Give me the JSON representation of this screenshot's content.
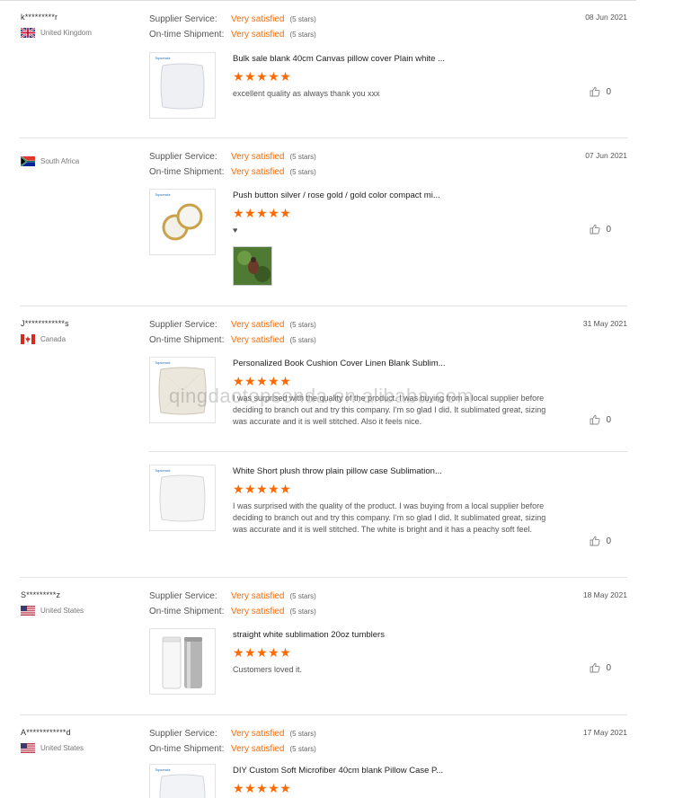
{
  "labels": {
    "supplier_service": "Supplier Service:",
    "ontime_shipment": "On-time Shipment:"
  },
  "watermark": "qingdaotopsenda.en.alibaba.com",
  "reviews": [
    {
      "user": "k*********r",
      "country": "United Kingdom",
      "flag": "uk",
      "date": "08 Jun 2021",
      "supplier_service": "Very satisfied",
      "supplier_service_stars": "(5 stars)",
      "ontime_shipment": "Very satisfied",
      "ontime_shipment_stars": "(5 stars)",
      "products": [
        {
          "title": "Bulk sale blank 40cm Canvas pillow cover Plain white ...",
          "stars": "★★★★★",
          "comment": "excellent quality as always thank you xxx",
          "likes": "0",
          "brand": "Topsenda"
        }
      ]
    },
    {
      "user": "",
      "country": "South Africa",
      "flag": "za",
      "date": "07 Jun 2021",
      "supplier_service": "Very satisfied",
      "supplier_service_stars": "(5 stars)",
      "ontime_shipment": "Very satisfied",
      "ontime_shipment_stars": "(5 stars)",
      "products": [
        {
          "title": "Push button silver / rose gold / gold color compact mi...",
          "stars": "★★★★★",
          "comment": "♥",
          "likes": "0",
          "brand": "Topsenda"
        }
      ]
    },
    {
      "user": "J************s",
      "country": "Canada",
      "flag": "ca",
      "date": "31 May 2021",
      "supplier_service": "Very satisfied",
      "supplier_service_stars": "(5 stars)",
      "ontime_shipment": "Very satisfied",
      "ontime_shipment_stars": "(5 stars)",
      "products": [
        {
          "title": "Personalized Book Cushion Cover Linen Blank Sublim...",
          "stars": "★★★★★",
          "comment": "I was surprised with the quality of the product. I was buying from a local supplier before deciding to branch out and try this company. I'm so glad I did. It sublimated great, sizing was accurate and it is well stitched. Also it feels nice.",
          "likes": "0",
          "brand": "Topsenda"
        },
        {
          "title": "White Short plush throw plain pillow case Sublimation...",
          "stars": "★★★★★",
          "comment": "I was surprised with the quality of the product. I was buying from a local supplier before deciding to branch out and try this company. I'm so glad I did. It sublimated great, sizing was accurate and it is well stitched. The white is bright and it has a peachy soft feel.",
          "likes": "0",
          "brand": "Topsenda"
        }
      ]
    },
    {
      "user": "S*********z",
      "country": "United States",
      "flag": "us",
      "date": "18 May 2021",
      "supplier_service": "Very satisfied",
      "supplier_service_stars": "(5 stars)",
      "ontime_shipment": "Very satisfied",
      "ontime_shipment_stars": "(5 stars)",
      "products": [
        {
          "title": "straight white sublimation 20oz tumblers",
          "stars": "★★★★★",
          "comment": "Customers loved it.",
          "likes": "0",
          "brand": ""
        }
      ]
    },
    {
      "user": "A************d",
      "country": "United States",
      "flag": "us",
      "date": "17 May 2021",
      "supplier_service": "Very satisfied",
      "supplier_service_stars": "(5 stars)",
      "ontime_shipment": "Very satisfied",
      "ontime_shipment_stars": "(5 stars)",
      "products": [
        {
          "title": "DIY Custom Soft Microfiber 40cm blank Pillow Case P...",
          "stars": "★★★★★",
          "comment": "",
          "likes": "",
          "brand": "Topsenda"
        }
      ]
    }
  ]
}
